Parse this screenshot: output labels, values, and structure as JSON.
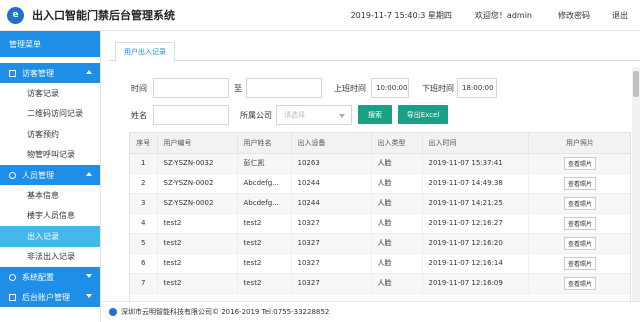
{
  "header": {
    "logo_char": "e",
    "title": "出入口智能门禁后台管理系统",
    "datetime": "2019-11-7 15:40:3 星期四",
    "welcome": "欢迎您！admin",
    "change_password": "修改密码",
    "logout": "退出"
  },
  "sidebar": {
    "menu_title": "管理菜单",
    "groups": [
      {
        "label": "访客管理",
        "items": [
          "访客记录",
          "二维码访问记录",
          "访客预约",
          "物管呼叫记录"
        ]
      },
      {
        "label": "人员管理",
        "items": [
          "基本信息",
          "楼宇人员信息",
          "出入记录",
          "非法出入记录"
        ]
      },
      {
        "label": "系统配置"
      },
      {
        "label": "后台账户管理"
      }
    ]
  },
  "tab": {
    "label": "用户出入记录"
  },
  "filters": {
    "time_label": "时间",
    "to_label": "至",
    "start_time": "",
    "end_time": "",
    "work_on_label": "上班时间",
    "work_on_value": "10:00:00",
    "work_off_label": "下班时间",
    "work_off_value": "18:00:00",
    "name_label": "姓名",
    "name_value": "",
    "company_label": "所属公司",
    "company_placeholder": "请选择",
    "search_button": "搜索",
    "export_button": "导出Excel"
  },
  "table": {
    "headers": [
      "序号",
      "用户编号",
      "用户姓名",
      "出入设备",
      "出入类型",
      "出入时间",
      "用户照片"
    ],
    "photo_button": "查看照片",
    "rows": [
      [
        "1",
        "SZ-YSZN-0032",
        "彭仁凯",
        "10263",
        "人脸",
        "2019-11-07 15:37:41"
      ],
      [
        "2",
        "SZ-YSZN-0002",
        "Abcdefg...",
        "10244",
        "人脸",
        "2019-11-07 14:49:38"
      ],
      [
        "3",
        "SZ-YSZN-0002",
        "Abcdefg...",
        "10244",
        "人脸",
        "2019-11-07 14:21:25"
      ],
      [
        "4",
        "test2",
        "test2",
        "10327",
        "人脸",
        "2019-11-07 12:16:27"
      ],
      [
        "5",
        "test2",
        "test2",
        "10327",
        "人脸",
        "2019-11-07 12:16:20"
      ],
      [
        "6",
        "test2",
        "test2",
        "10327",
        "人脸",
        "2019-11-07 12:16:14"
      ],
      [
        "7",
        "test2",
        "test2",
        "10327",
        "人脸",
        "2019-11-07 12:16:09"
      ]
    ]
  },
  "footer": {
    "text": "深圳市云明智能科技有限公司© 2016-2019 Tel:0755-33228852"
  },
  "colors": {
    "primary": "#1e8ee6",
    "active": "#43b8ea",
    "button": "#1aa185"
  }
}
